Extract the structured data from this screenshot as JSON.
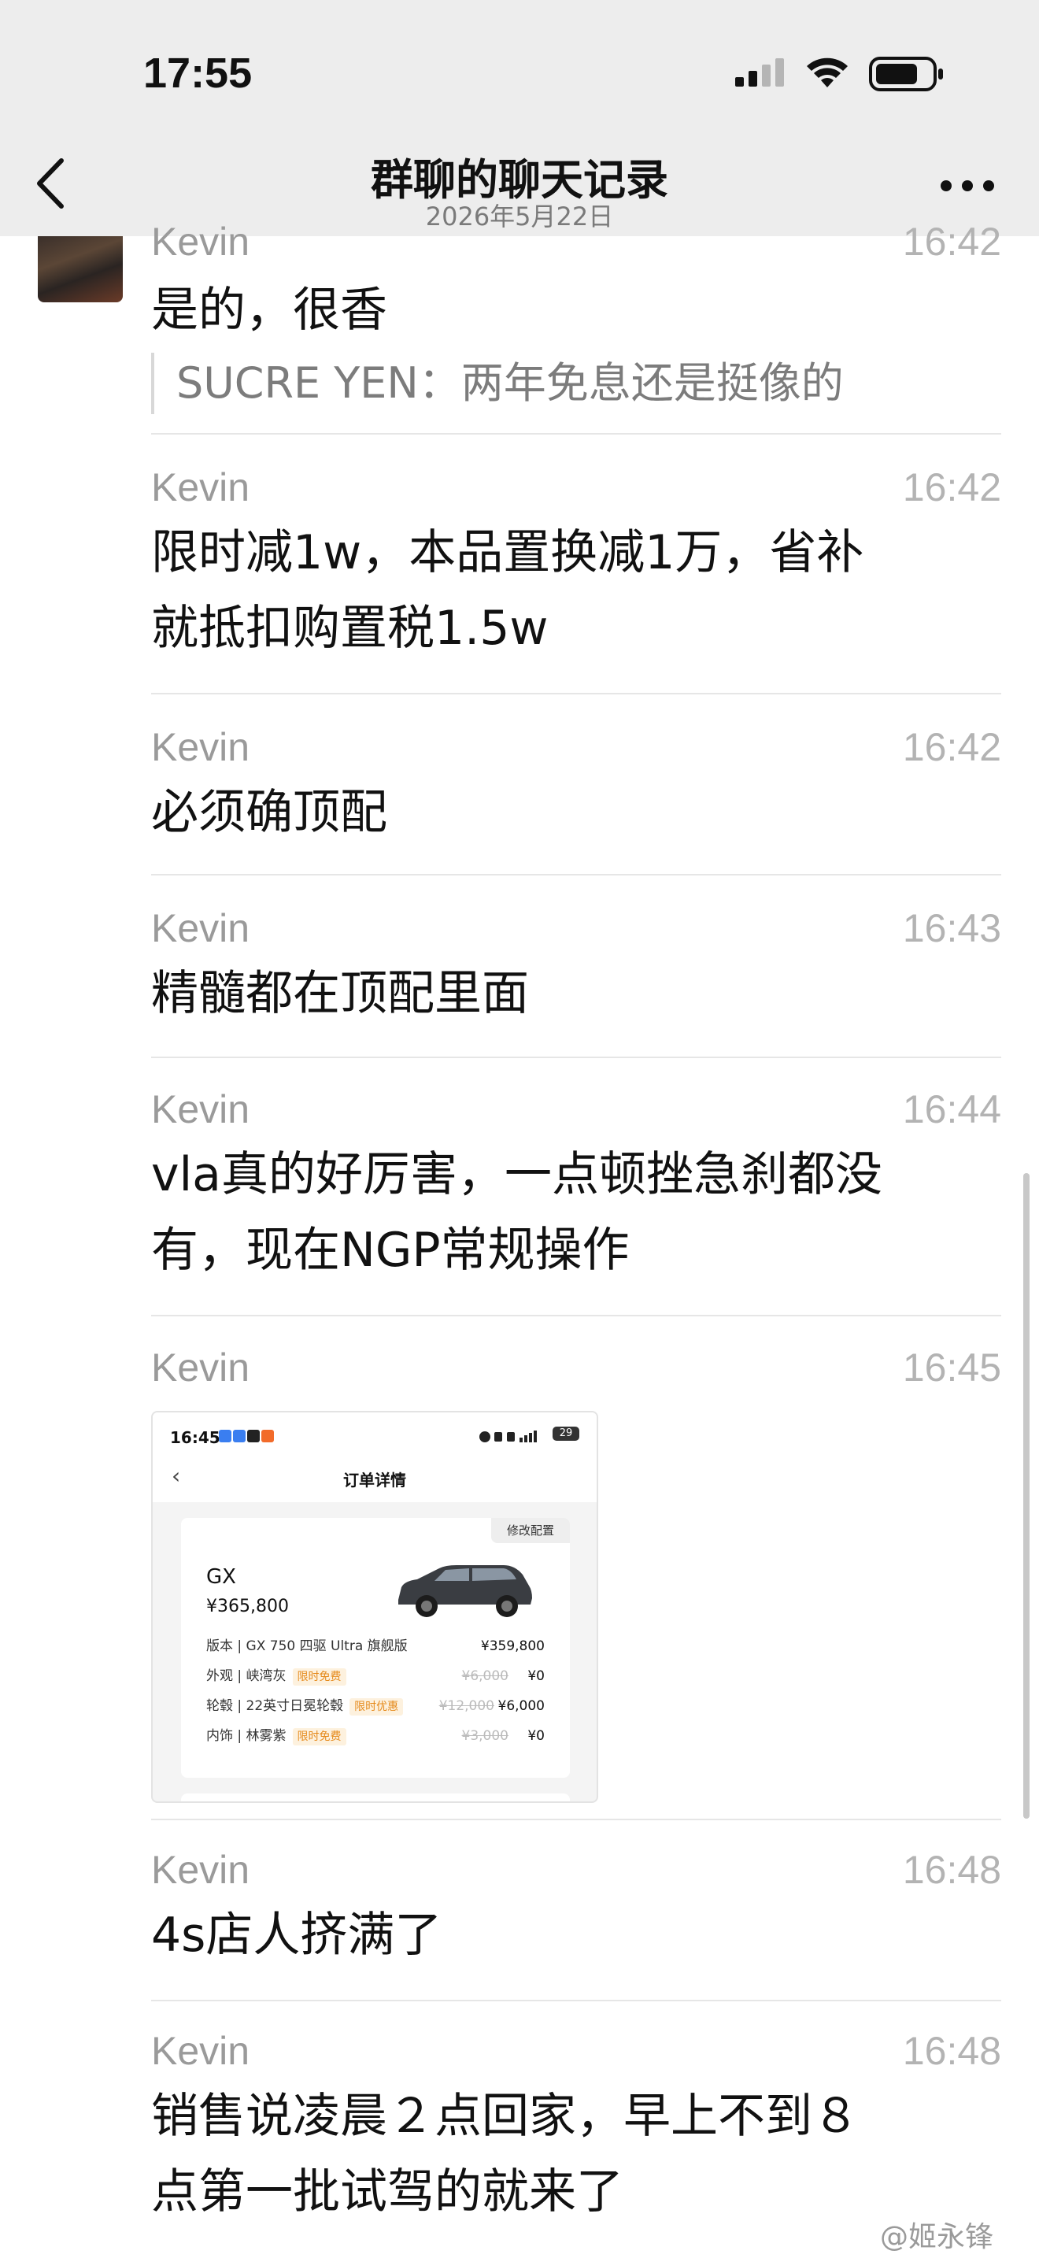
{
  "status_bar": {
    "time": "17:55"
  },
  "nav": {
    "title": "群聊的聊天记录",
    "subtitle": "2026年5月22日"
  },
  "messages": [
    {
      "sender": "Kevin",
      "time": "16:42",
      "text": "是的，很香",
      "quote": "SUCRE YEN：两年免息还是挺像的"
    },
    {
      "sender": "Kevin",
      "time": "16:42",
      "lines": [
        "限时减1w，本品置换减1万，省补",
        "就抵扣购置税1.5w"
      ]
    },
    {
      "sender": "Kevin",
      "time": "16:42",
      "text": "必须确顶配"
    },
    {
      "sender": "Kevin",
      "time": "16:43",
      "text": "精髓都在顶配里面"
    },
    {
      "sender": "Kevin",
      "time": "16:44",
      "lines": [
        "vla真的好厉害，一点顿挫急刹都没",
        "有，现在NGP常规操作"
      ]
    },
    {
      "sender": "Kevin",
      "time": "16:45"
    },
    {
      "sender": "Kevin",
      "time": "16:48",
      "text": "4s店人挤满了"
    },
    {
      "sender": "Kevin",
      "time": "16:48",
      "lines": [
        "销售说凌晨２点回家，早上不到８",
        "点第一批试驾的就来了"
      ]
    }
  ],
  "image_card": {
    "status_time": "16:45",
    "battery": "29",
    "page_title": "订单详情",
    "edit_label": "修改配置",
    "model": "GX",
    "price": "¥365,800",
    "rows": [
      {
        "label": "版本 | GX 750 四驱 Ultra 旗舰版",
        "tag": "",
        "old": "",
        "price": "¥359,800"
      },
      {
        "label": "外观 | 峡湾灰",
        "tag": "限时免费",
        "old": "¥6,000",
        "price": "¥0"
      },
      {
        "label": "轮毂 | 22英寸日冕轮毂",
        "tag": "限时优惠",
        "old": "¥12,000",
        "price": "¥6,000"
      },
      {
        "label": "内饰 | 林雾紫",
        "tag": "限时免费",
        "old": "¥3,000",
        "price": "¥0"
      }
    ]
  },
  "watermark": "@姬永锋",
  "icons": [
    "signal-icon",
    "wifi-icon",
    "battery-icon",
    "back-chevron-icon",
    "more-dots-icon",
    "car-image"
  ]
}
